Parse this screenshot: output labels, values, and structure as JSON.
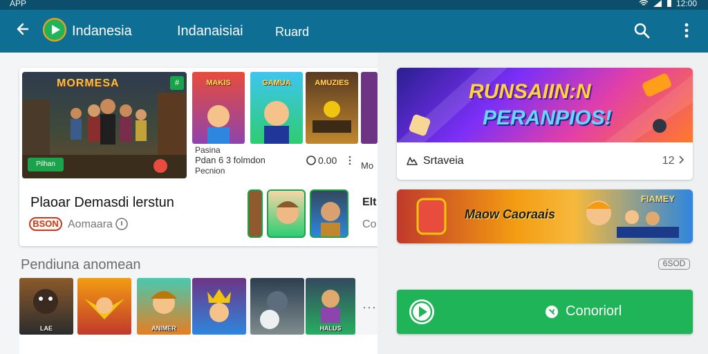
{
  "status_bar": {
    "app_label": "APP",
    "time": "12:00"
  },
  "app_bar": {
    "title": "Indanesia",
    "tabs": [
      {
        "label": "Indanaisiai"
      },
      {
        "label": "Ruard"
      }
    ]
  },
  "featured_card": {
    "hero_title": "MORMESA",
    "hero_tag": "Pilhan",
    "hero_badge": "#",
    "thumbnails": [
      {
        "label": "MAKIS"
      },
      {
        "label": "GAMUA"
      },
      {
        "label": "AMUZIES"
      }
    ],
    "meta": [
      "Pasina",
      "Pdan 6 3 folmdon",
      "Pecnion"
    ],
    "price": "0.00",
    "title": "Plaoar Demasdi lerstun",
    "rating_badge": "BSON",
    "rating_label": "Aomaara",
    "edge_text_1": "Elt",
    "edge_text_2": "Co",
    "edge_more": "Mo"
  },
  "section": {
    "title": "Pendiuna anomean",
    "tiles": [
      {
        "label": "LAE"
      },
      {
        "label": ""
      },
      {
        "label": "ANIMER"
      },
      {
        "label": ""
      },
      {
        "label": ""
      },
      {
        "label": "HALUS"
      }
    ],
    "more": "···"
  },
  "right_panel": {
    "banner1_title": "RUNSAIIN:N",
    "banner1_subtitle": "PERANPIOS!",
    "banner1_meta_label": "Srtaveia",
    "banner1_meta_count": "12",
    "banner2_title": "Maow Caoraais",
    "banner2_corner": "FIAMEY",
    "size_badge": "6SOD",
    "install_label": "Conoriorl"
  },
  "colors": {
    "app_bar": "#0e6e93",
    "accent_green": "#1fb457",
    "status_bar": "#0b4f6c"
  }
}
